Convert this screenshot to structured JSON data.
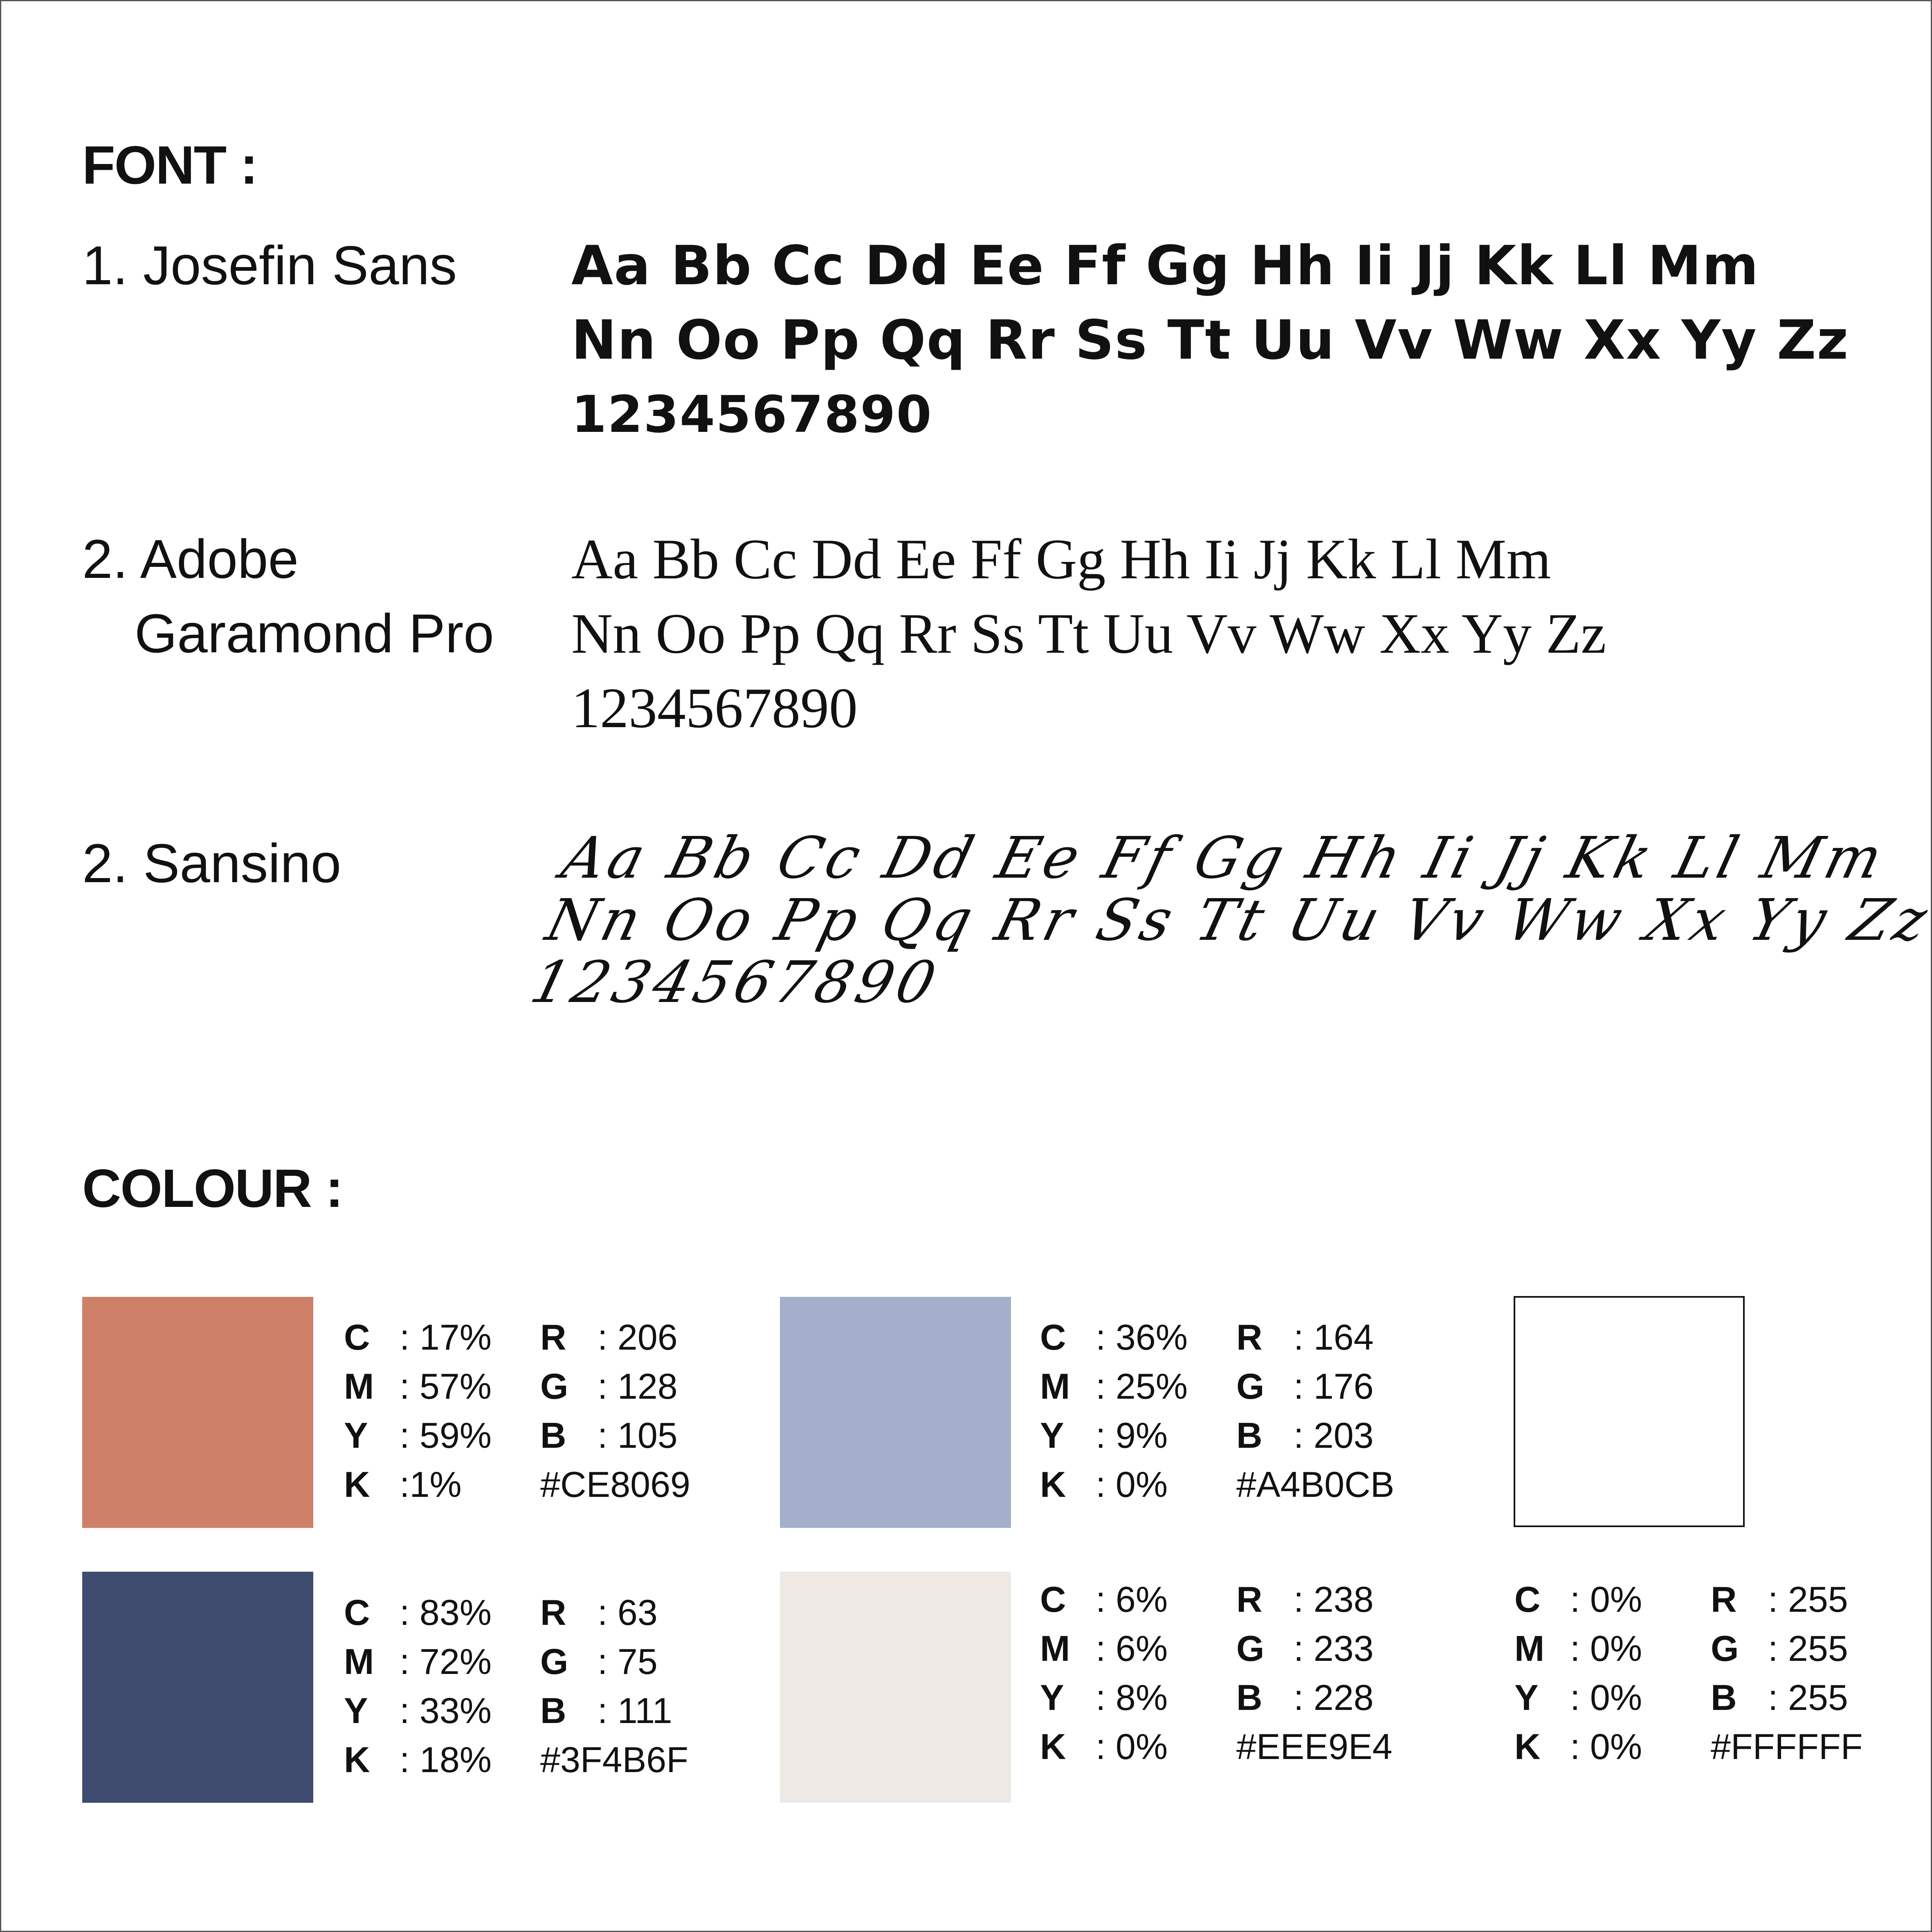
{
  "font_heading": "FONT :",
  "fonts": [
    {
      "label_line1": "1. Josefin Sans",
      "label_line2": "",
      "rows": [
        "Aa Bb Cc Dd Ee Ff Gg Hh Ii Jj Kk Ll Mm",
        "Nn Oo Pp Qq Rr Ss Tt Uu Vv Ww Xx Yy Zz",
        "1234567890"
      ]
    },
    {
      "label_line1": "2. Adobe",
      "label_line2": "Garamond Pro",
      "rows": [
        "Aa Bb Cc Dd Ee Ff Gg Hh Ii Jj Kk Ll Mm",
        "Nn Oo Pp Qq Rr Ss Tt Uu Vv Ww Xx Yy Zz",
        "1234567890"
      ]
    },
    {
      "label_line1": "2. Sansino",
      "label_line2": "",
      "rows": [
        "Aa Bb Cc Dd Ee Ff Gg Hh Ii Jj Kk Ll Mm",
        "Nn Oo Pp Qq Rr Ss Tt Uu Vv Ww Xx Yy Zz",
        "1234567890"
      ]
    }
  ],
  "colour_heading": "COLOUR :",
  "colours": [
    {
      "swatch": "#CE8069",
      "c_label": "C",
      "c": ": 17%",
      "m_label": "M",
      "m": ": 57%",
      "y_label": "Y",
      "y": ": 59%",
      "k_label": "K",
      "k": ":1%",
      "r_label": "R",
      "r": ": 206",
      "g_label": "G",
      "g": ": 128",
      "b_label": "B",
      "b": ": 105",
      "hex": "#CE8069"
    },
    {
      "swatch": "#A4B0CB",
      "c_label": "C",
      "c": ": 36%",
      "m_label": "M",
      "m": ": 25%",
      "y_label": "Y",
      "y": ": 9%",
      "k_label": "K",
      "k": ": 0%",
      "r_label": "R",
      "r": ": 164",
      "g_label": "G",
      "g": ": 176",
      "b_label": "B",
      "b": ": 203",
      "hex": "#A4B0CB"
    },
    {
      "swatch": "#3F4B6F",
      "c_label": "C",
      "c": ": 83%",
      "m_label": "M",
      "m": ": 72%",
      "y_label": "Y",
      "y": ": 33%",
      "k_label": "K",
      "k": ": 18%",
      "r_label": "R",
      "r": ": 63",
      "g_label": "G",
      "g": ": 75",
      "b_label": "B",
      "b": ": 111",
      "hex": "#3F4B6F"
    },
    {
      "swatch": "#EEE9E4",
      "c_label": "C",
      "c": ": 6%",
      "m_label": "M",
      "m": ": 6%",
      "y_label": "Y",
      "y": ": 8%",
      "k_label": "K",
      "k": ": 0%",
      "r_label": "R",
      "r": ": 238",
      "g_label": "G",
      "g": ": 233",
      "b_label": "B",
      "b": ": 228",
      "hex": "#EEE9E4"
    },
    {
      "swatch": "#FFFFFF",
      "c_label": "C",
      "c": ": 0%",
      "m_label": "M",
      "m": ": 0%",
      "y_label": "Y",
      "y": ": 0%",
      "k_label": "K",
      "k": ": 0%",
      "r_label": "R",
      "r": ": 255",
      "g_label": "G",
      "g": ": 255",
      "b_label": "B",
      "b": ": 255",
      "hex": "#FFFFFF"
    }
  ]
}
